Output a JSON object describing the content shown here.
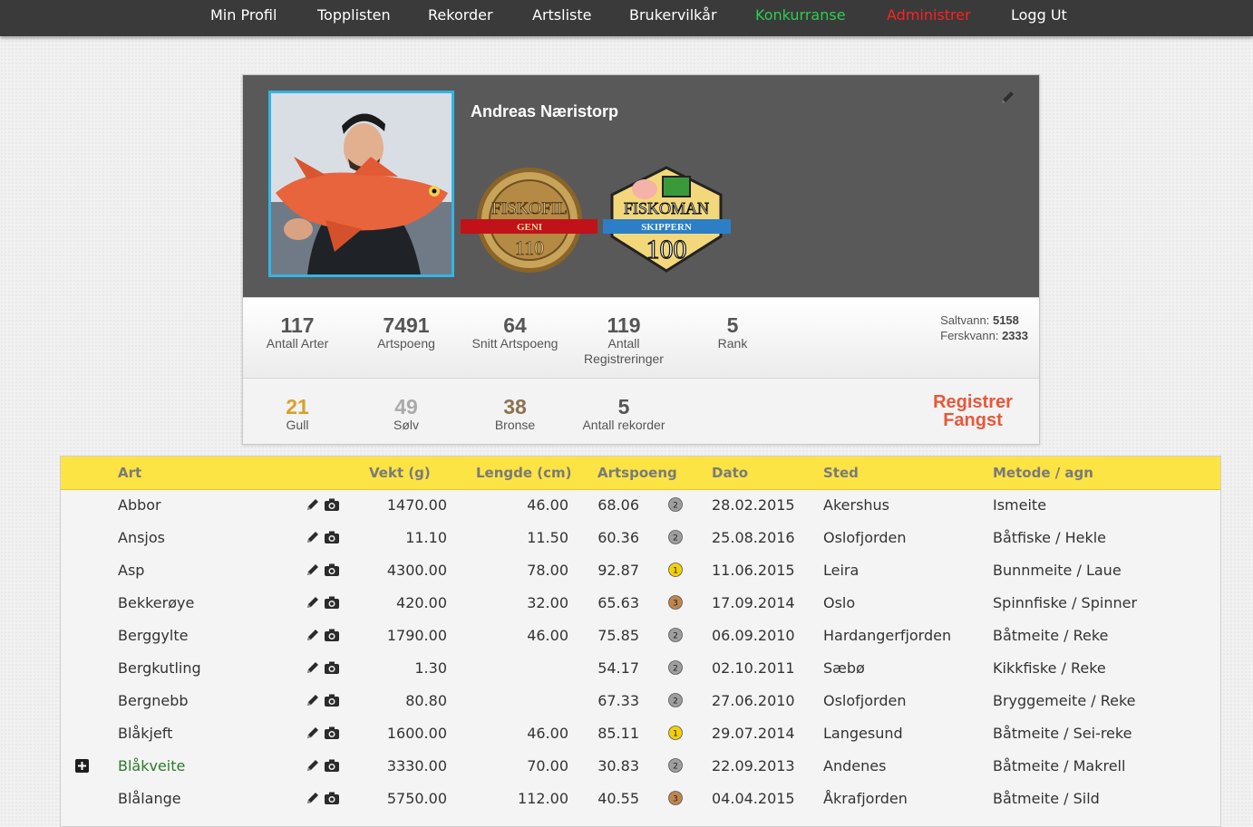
{
  "nav": {
    "items": [
      {
        "label": "Min Profil",
        "color": "#ffffff"
      },
      {
        "label": "Topplisten",
        "color": "#ffffff"
      },
      {
        "label": "Rekorder",
        "color": "#ffffff"
      },
      {
        "label": "Artsliste",
        "color": "#ffffff"
      },
      {
        "label": "Brukervilkår",
        "color": "#ffffff"
      },
      {
        "label": "Konkurranse",
        "color": "#2ecc52"
      },
      {
        "label": "Administrer",
        "color": "#ff2020"
      },
      {
        "label": "Logg Ut",
        "color": "#ffffff"
      }
    ]
  },
  "profile": {
    "name": "Andreas Næristorp",
    "badges": [
      {
        "word": "FISKOFIL",
        "ribbon": "GENI",
        "number": "110",
        "icon": "gold-seal-badge"
      },
      {
        "word": "FISKOMAN",
        "ribbon": "SKIPPERN",
        "number": "100",
        "icon": "popeye-badge"
      }
    ],
    "stats": [
      {
        "value": "117",
        "label": "Antall Arter"
      },
      {
        "value": "7491",
        "label": "Artspoeng"
      },
      {
        "value": "64",
        "label": "Snitt Artspoeng"
      },
      {
        "value": "119",
        "label": "Antall Registreringer"
      },
      {
        "value": "5",
        "label": "Rank"
      }
    ],
    "water": {
      "salt_label": "Saltvann:",
      "salt_value": "5158",
      "fresh_label": "Ferskvann:",
      "fresh_value": "2333"
    },
    "medals": [
      {
        "value": "21",
        "label": "Gull",
        "color": "#d9a02a"
      },
      {
        "value": "49",
        "label": "Sølv",
        "color": "#aaaaaa"
      },
      {
        "value": "38",
        "label": "Bronse",
        "color": "#8a7350"
      },
      {
        "value": "5",
        "label": "Antall rekorder",
        "color": "#555555"
      }
    ],
    "register_button": {
      "line1": "Registrer",
      "line2": "Fangst"
    }
  },
  "table": {
    "headers": {
      "art": "Art",
      "weight": "Vekt (g)",
      "length": "Lengde (cm)",
      "score": "Artspoeng",
      "date": "Dato",
      "place": "Sted",
      "method": "Metode / agn"
    },
    "rows": [
      {
        "art": "Abbor",
        "weight": "1470.00",
        "length": "46.00",
        "score": "68.06",
        "medal": "2",
        "date": "28.02.2015",
        "place": "Akershus",
        "method": "Ismeite"
      },
      {
        "art": "Ansjos",
        "weight": "11.10",
        "length": "11.50",
        "score": "60.36",
        "medal": "2",
        "date": "25.08.2016",
        "place": "Oslofjorden",
        "method": "Båtfiske / Hekle"
      },
      {
        "art": "Asp",
        "weight": "4300.00",
        "length": "78.00",
        "score": "92.87",
        "medal": "1",
        "date": "11.06.2015",
        "place": "Leira",
        "method": "Bunnmeite / Laue"
      },
      {
        "art": "Bekkerøye",
        "weight": "420.00",
        "length": "32.00",
        "score": "65.63",
        "medal": "3",
        "date": "17.09.2014",
        "place": "Oslo",
        "method": "Spinnfiske / Spinner"
      },
      {
        "art": "Berggylte",
        "weight": "1790.00",
        "length": "46.00",
        "score": "75.85",
        "medal": "2",
        "date": "06.09.2010",
        "place": "Hardangerfjorden",
        "method": "Båtmeite / Reke"
      },
      {
        "art": "Bergkutling",
        "weight": "1.30",
        "length": "",
        "score": "54.17",
        "medal": "2",
        "date": "02.10.2011",
        "place": "Sæbø",
        "method": "Kikkfiske / Reke"
      },
      {
        "art": "Bergnebb",
        "weight": "80.80",
        "length": "",
        "score": "67.33",
        "medal": "2",
        "date": "27.06.2010",
        "place": "Oslofjorden",
        "method": "Bryggemeite / Reke"
      },
      {
        "art": "Blåkjeft",
        "weight": "1600.00",
        "length": "46.00",
        "score": "85.11",
        "medal": "1",
        "date": "29.07.2014",
        "place": "Langesund",
        "method": "Båtmeite / Sei-reke"
      },
      {
        "art": "Blåkveite",
        "weight": "3330.00",
        "length": "70.00",
        "score": "30.83",
        "medal": "2",
        "date": "22.09.2013",
        "place": "Andenes",
        "method": "Båtmeite / Makrell",
        "expandable": true
      },
      {
        "art": "Blålange",
        "weight": "5750.00",
        "length": "112.00",
        "score": "40.55",
        "medal": "3",
        "date": "04.04.2015",
        "place": "Åkrafjorden",
        "method": "Båtmeite / Sild"
      }
    ],
    "medal_colors": {
      "1": "#f2cf0c",
      "2": "#9e9e9e",
      "3": "#c08650"
    }
  }
}
